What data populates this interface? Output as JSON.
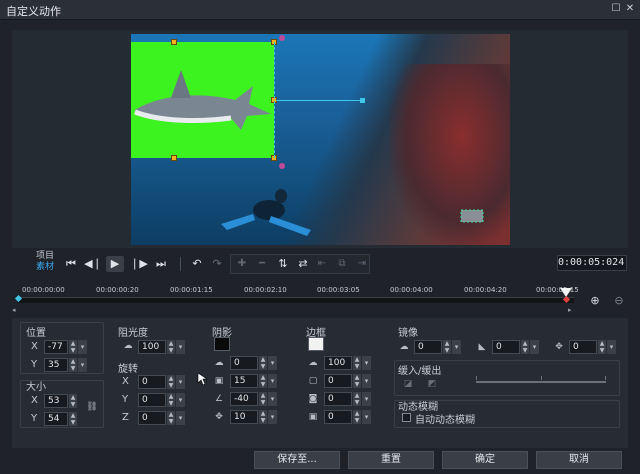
{
  "window": {
    "title": "自定义动作"
  },
  "playback": {
    "mode_project": "项目",
    "mode_clip": "素材",
    "timecode": "0:00:05:024"
  },
  "ruler": {
    "ticks": [
      "00:00:00:00",
      "00:00:00:20",
      "00:00:01:15",
      "00:00:02:10",
      "00:00:03:05",
      "00:00:04:00",
      "00:00:04:20",
      "00:00:05:15"
    ]
  },
  "position": {
    "label": "位置",
    "x_label": "X",
    "x_value": "-77",
    "y_label": "Y",
    "y_value": "35"
  },
  "size": {
    "label": "大小",
    "x_label": "X",
    "x_value": "53",
    "y_label": "Y",
    "y_value": "54"
  },
  "opacity": {
    "label": "阻光度",
    "value": "100"
  },
  "rotation": {
    "label": "旋转",
    "x_label": "X",
    "x_value": "0",
    "y_label": "Y",
    "y_value": "0",
    "z_label": "Z",
    "z_value": "0"
  },
  "shadow": {
    "label": "阴影",
    "color": "#0a0a0a",
    "opacity_value": "0",
    "blur_value": "15",
    "angle_value": "-40",
    "distance_value": "10"
  },
  "border": {
    "label": "边框",
    "color": "#f2f2f2",
    "opacity_value": "100",
    "width_value": "0",
    "v2": "0",
    "v3": "0"
  },
  "mirror": {
    "label": "镜像",
    "v1": "0",
    "v2": "0",
    "v3": "0"
  },
  "ease": {
    "label": "缓入/缓出"
  },
  "motion_blur": {
    "label": "动态模糊",
    "auto_label": "自动动态模糊"
  },
  "footer": {
    "save_as": "保存至...",
    "reset": "重置",
    "ok": "确定",
    "cancel": "取消"
  },
  "colors": {
    "accent": "#39a9f0",
    "green_screen": "#3cf21f",
    "handle": "#f1b21a"
  }
}
